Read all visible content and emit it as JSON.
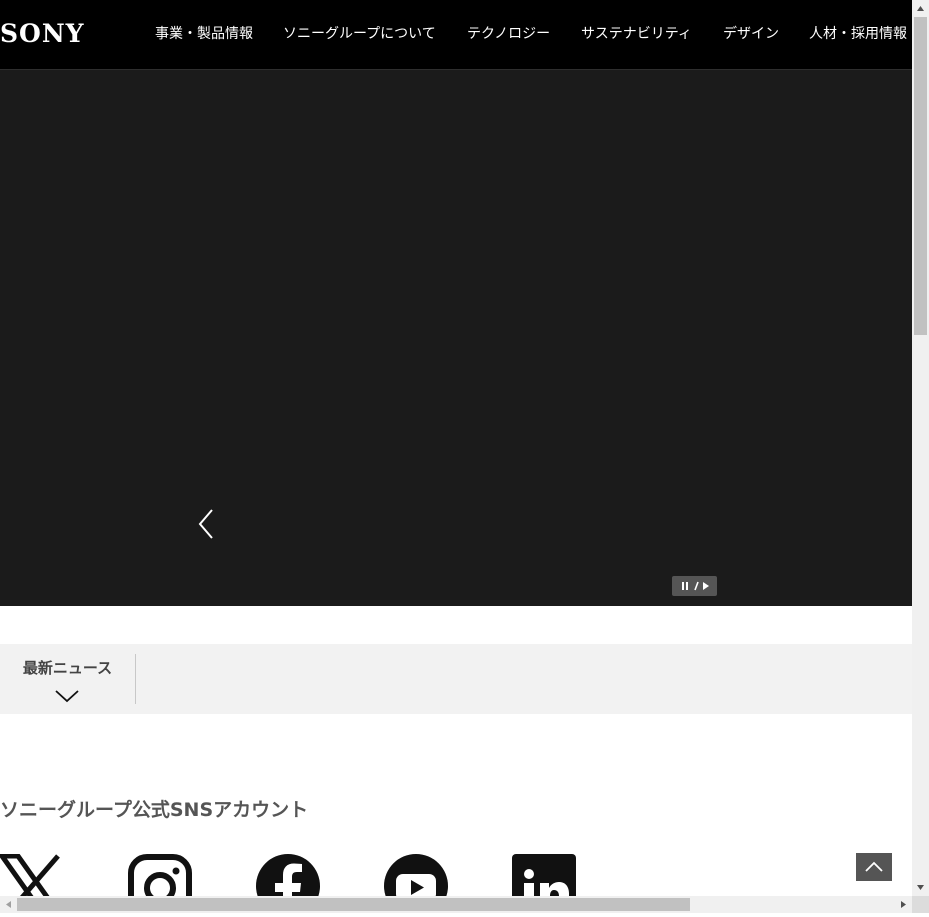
{
  "header": {
    "logo": "SONY",
    "nav": [
      "事業・製品情報",
      "ソニーグループについて",
      "テクノロジー",
      "サステナビリティ",
      "デザイン",
      "人材・採用情報"
    ]
  },
  "hero": {
    "prev_icon": "chevron-left-icon",
    "control_icon": "pause-play-icon"
  },
  "news": {
    "label": "最新ニュース",
    "toggle_icon": "chevron-down-icon"
  },
  "sns": {
    "title": "ソニーグループ公式SNSアカウント",
    "icons": [
      "x-icon",
      "instagram-icon",
      "facebook-icon",
      "youtube-icon",
      "linkedin-icon"
    ]
  },
  "colors": {
    "header_bg": "#000000",
    "hero_bg": "#1b1b1b",
    "news_bg": "#f2f2f2",
    "control_bg": "#555555"
  }
}
